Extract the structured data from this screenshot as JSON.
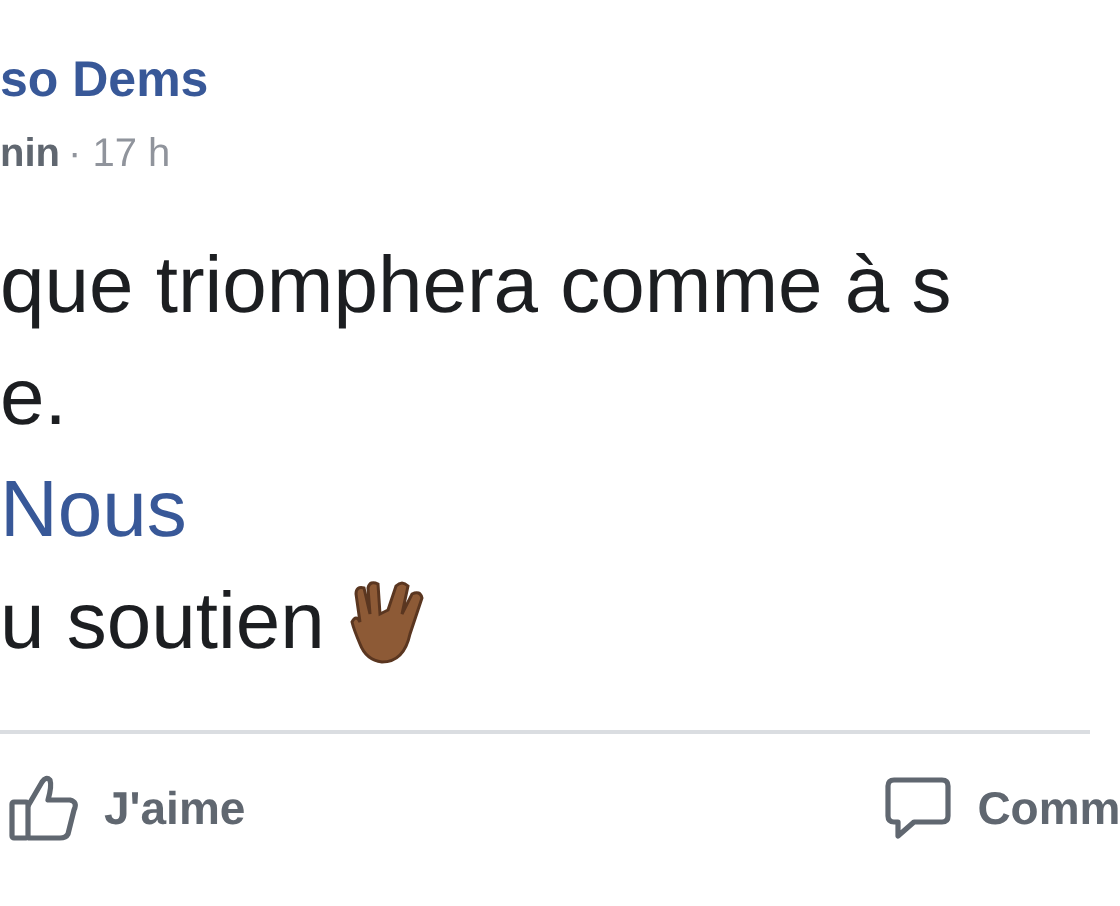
{
  "post": {
    "author": "so Dems",
    "role": "nin",
    "time": "· 17 h",
    "lines": [
      {
        "kind": "text",
        "text": "que triomphera comme à s"
      },
      {
        "kind": "text",
        "text": "e."
      },
      {
        "kind": "link",
        "text": "Nous"
      },
      {
        "kind": "emoji",
        "text": "u soutien"
      }
    ]
  },
  "actions": [
    {
      "kind": "like",
      "label": "J'aime"
    },
    {
      "kind": "comment",
      "label": "Comm"
    }
  ]
}
